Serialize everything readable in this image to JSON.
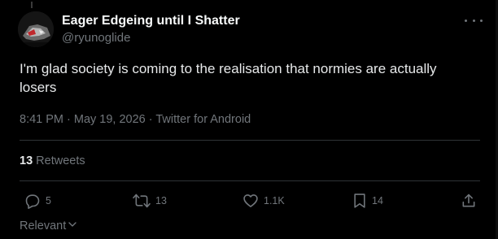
{
  "author": {
    "display_name": "Eager Edgeing until I Shatter",
    "handle": "@ryunoglide"
  },
  "tweet": {
    "text": "I'm glad society is coming to the realisation that normies are actually losers",
    "meta": "8:41 PM · May 19, 2026 · Twitter for Android"
  },
  "stats": {
    "retweet_count": "13",
    "retweet_label": " Retweets"
  },
  "actions": {
    "reply": {
      "icon": "reply-icon",
      "count": "5"
    },
    "retweet": {
      "icon": "retweet-icon",
      "count": "13"
    },
    "like": {
      "icon": "heart-icon",
      "count": "1.1K"
    },
    "bookmark": {
      "icon": "bookmark-icon",
      "count": "14"
    },
    "share": {
      "icon": "share-icon"
    }
  },
  "sort": {
    "label": "Relevant",
    "icon": "chevron-down-icon"
  },
  "colors": {
    "background": "#000000",
    "primary_text": "#e7e9ea",
    "secondary_text": "#71767b",
    "divider": "#2f3336"
  }
}
